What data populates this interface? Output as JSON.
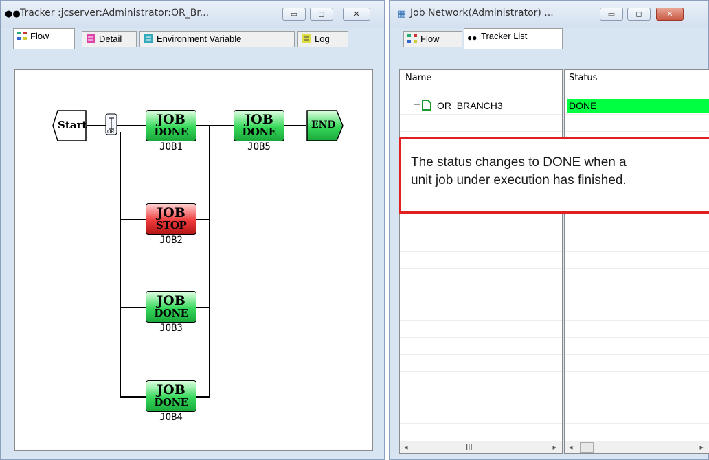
{
  "left_window": {
    "title": "Tracker :jcserver:Administrator:OR_Br...",
    "title_icon": "binoculars-icon",
    "controls": {
      "minimize": "▭",
      "maximize": "◻",
      "close": "✕"
    },
    "tabs": [
      {
        "label": "Flow",
        "icon": "flow-icon",
        "active": true
      },
      {
        "label": "Detail",
        "icon": "detail-icon",
        "active": false
      },
      {
        "label": "Environment Variable",
        "icon": "env-var-icon",
        "active": false
      },
      {
        "label": "Log",
        "icon": "log-icon",
        "active": false
      }
    ],
    "flow": {
      "start_label": "Start",
      "end_label": "END",
      "branch_icon": "or-branch-icon",
      "jobs": [
        {
          "name": "JOB1",
          "line1": "JOB",
          "line2": "DONE",
          "state": "done"
        },
        {
          "name": "JOB2",
          "line1": "JOB",
          "line2": "STOP",
          "state": "stop"
        },
        {
          "name": "JOB3",
          "line1": "JOB",
          "line2": "DONE",
          "state": "done"
        },
        {
          "name": "JOB4",
          "line1": "JOB",
          "line2": "DONE",
          "state": "done"
        },
        {
          "name": "JOB5",
          "line1": "JOB",
          "line2": "DONE",
          "state": "done"
        }
      ]
    }
  },
  "right_window": {
    "title": "Job Network(Administrator) ...",
    "title_icon": "job-network-icon",
    "controls": {
      "minimize": "▭",
      "maximize": "◻",
      "close": "✕"
    },
    "tabs": [
      {
        "label": "Flow",
        "icon": "flow-icon",
        "active": false
      },
      {
        "label": "Tracker List",
        "icon": "binoculars-icon",
        "active": true
      }
    ],
    "columns": {
      "name": "Name",
      "status": "Status"
    },
    "rows": [
      {
        "name": "OR_BRANCH3",
        "status": "DONE",
        "status_color": "#00ff40"
      }
    ],
    "scrollbar": {
      "left_arrow": "◂",
      "right_arrow": "▸",
      "grip": "III"
    }
  },
  "callout": {
    "text_line1": "The status changes to DONE when a",
    "text_line2": "unit job under execution has finished.",
    "border_color": "#e02020"
  }
}
